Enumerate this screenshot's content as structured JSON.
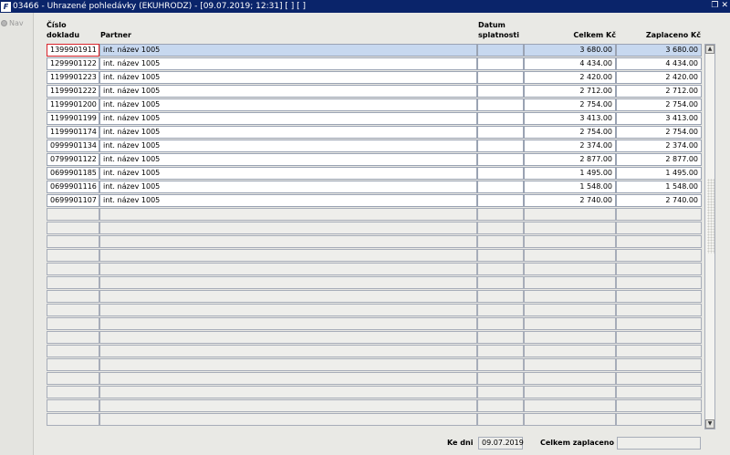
{
  "window": {
    "title": "03466 - Uhrazené pohledávky (EKUHRODZ) - [09.07.2019; 12:31]  [ ]  [ ]",
    "app_icon": "F",
    "controls": [
      "restore-icon",
      "close-icon"
    ]
  },
  "nav": {
    "label": "Nav"
  },
  "columns": {
    "doc_line1": "Číslo",
    "doc_line2": "dokladu",
    "partner": "Partner",
    "due_line1": "Datum",
    "due_line2": "splatnosti",
    "total": "Celkem Kč",
    "paid": "Zaplaceno Kč"
  },
  "rows": [
    {
      "doc": "1399901911",
      "partner": "int. název 1005",
      "due": "",
      "total": "3 680.00",
      "paid": "3 680.00"
    },
    {
      "doc": "1299901122",
      "partner": "int. název 1005",
      "due": "",
      "total": "4 434.00",
      "paid": "4 434.00"
    },
    {
      "doc": "1199901223",
      "partner": "int. název 1005",
      "due": "",
      "total": "2 420.00",
      "paid": "2 420.00"
    },
    {
      "doc": "1199901222",
      "partner": "int. název 1005",
      "due": "",
      "total": "2 712.00",
      "paid": "2 712.00"
    },
    {
      "doc": "1199901200",
      "partner": "int. název 1005",
      "due": "",
      "total": "2 754.00",
      "paid": "2 754.00"
    },
    {
      "doc": "1199901199",
      "partner": "int. název 1005",
      "due": "",
      "total": "3 413.00",
      "paid": "3 413.00"
    },
    {
      "doc": "1199901174",
      "partner": "int. název 1005",
      "due": "",
      "total": "2 754.00",
      "paid": "2 754.00"
    },
    {
      "doc": "0999901134",
      "partner": "int. název 1005",
      "due": "",
      "total": "2 374.00",
      "paid": "2 374.00"
    },
    {
      "doc": "0799901122",
      "partner": "int. název 1005",
      "due": "",
      "total": "2 877.00",
      "paid": "2 877.00"
    },
    {
      "doc": "0699901185",
      "partner": "int. název 1005",
      "due": "",
      "total": "1 495.00",
      "paid": "1 495.00"
    },
    {
      "doc": "0699901116",
      "partner": "int. název 1005",
      "due": "",
      "total": "1 548.00",
      "paid": "1 548.00"
    },
    {
      "doc": "0699901107",
      "partner": "int. název 1005",
      "due": "",
      "total": "2 740.00",
      "paid": "2 740.00"
    }
  ],
  "empty_rows": 16,
  "footer": {
    "date_label": "Ke dni",
    "date_value": "09.07.2019",
    "total_paid_label": "Celkem zaplaceno",
    "total_paid_value": ""
  },
  "colors": {
    "titlebar": "#0a246a",
    "selected_row": "#c7d8ef",
    "focus_border": "#d9232b"
  }
}
